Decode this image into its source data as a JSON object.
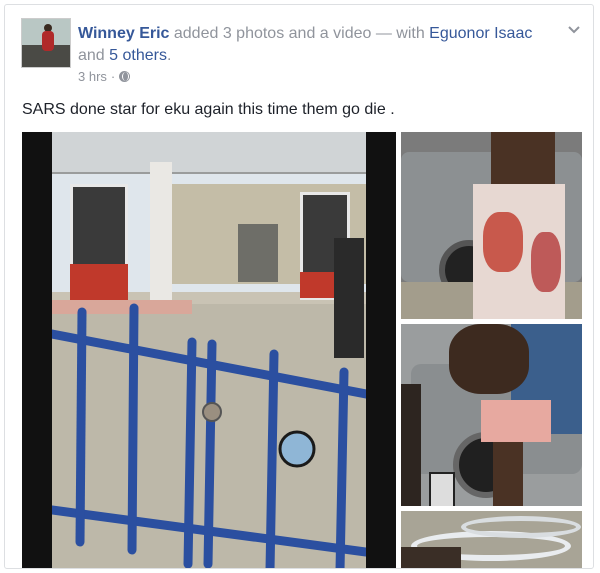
{
  "post": {
    "author": "Winney Eric",
    "action_text": " added 3 photos and a video — with ",
    "tagged_person": "Eguonor Isaac",
    "and_text": " and ",
    "others_link": "5 others",
    "period": ".",
    "timestamp": "3 hrs",
    "separator": "·",
    "privacy_icon": "globe-icon",
    "menu_icon": "chevron-down-icon",
    "text": "SARS done star for eku again this time them go die ."
  },
  "colors": {
    "link": "#365899",
    "meta": "#90949c",
    "body_text": "#1d2129",
    "border": "#dddfe2"
  },
  "media": {
    "video_icon": "video-thumbnail",
    "photo_count": 3
  }
}
